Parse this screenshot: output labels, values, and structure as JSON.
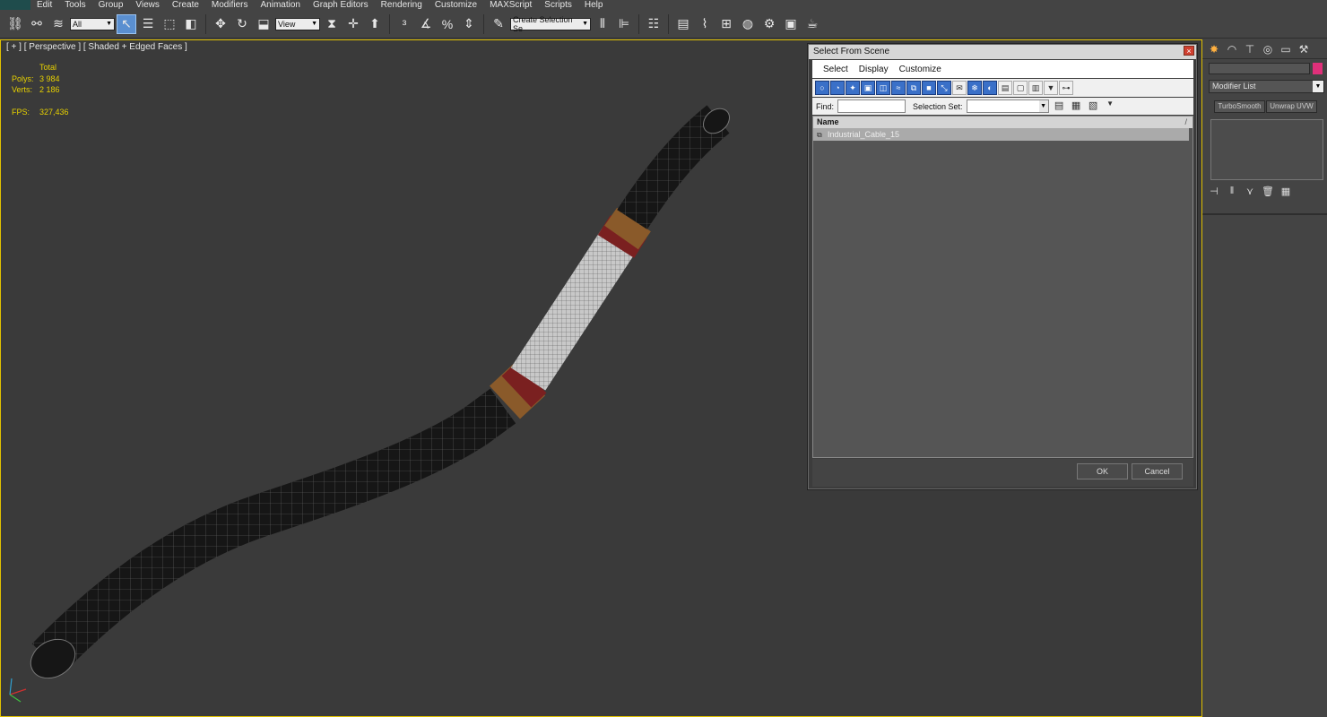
{
  "menubar": {
    "items": [
      "Edit",
      "Tools",
      "Group",
      "Views",
      "Create",
      "Modifiers",
      "Animation",
      "Graph Editors",
      "Rendering",
      "Customize",
      "MAXScript",
      "Scripts",
      "Help"
    ]
  },
  "toolbar": {
    "selection_filter": "All",
    "reference_coord": "View",
    "named_selection_placeholder": "Create Selection Se"
  },
  "viewport": {
    "label": "[ + ] [ Perspective ] [ Shaded + Edged Faces ]",
    "stats": {
      "total_label": "Total",
      "polys_label": "Polys:",
      "polys_value": "3 984",
      "verts_label": "Verts:",
      "verts_value": "2 186",
      "fps_label": "FPS:",
      "fps_value": "327,436"
    },
    "stat_color": "#e6d000",
    "border_color": "#e0c000"
  },
  "command_panel": {
    "modifier_list": "Modifier List",
    "modifier_buttons": [
      "TurboSmooth",
      "Unwrap UVW"
    ],
    "object_color": "#e0307a"
  },
  "dialog": {
    "title": "Select From Scene",
    "close_label": "×",
    "menu": [
      "Select",
      "Display",
      "Customize"
    ],
    "find_label": "Find:",
    "selection_set_label": "Selection Set:",
    "list_header": "Name",
    "sort_indicator": "/",
    "rows": [
      {
        "name": "Industrial_Cable_15"
      }
    ],
    "ok_label": "OK",
    "cancel_label": "Cancel"
  }
}
